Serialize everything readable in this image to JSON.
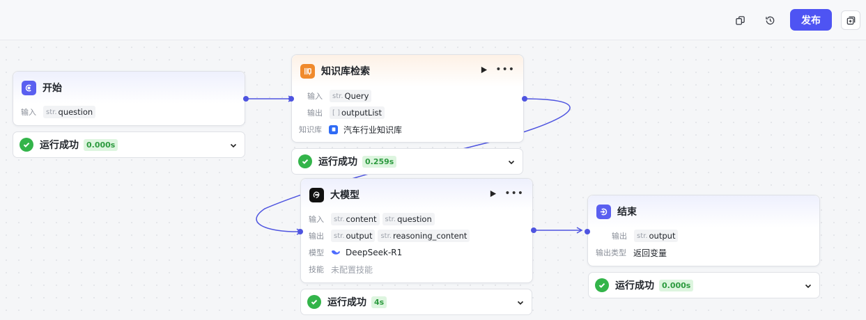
{
  "toolbar": {
    "icons": [
      "copy-icon",
      "history-icon",
      "import-icon"
    ],
    "publish_label": "发布"
  },
  "nodes": {
    "start": {
      "title": "开始",
      "icon": "start-icon",
      "input_label": "输入",
      "input_type": "str.",
      "input_name": "question",
      "status": "运行成功",
      "time": "0.000s"
    },
    "kb": {
      "title": "知识库检索",
      "icon": "knowledge-search-icon",
      "input_label": "输入",
      "input_type": "str.",
      "input_name": "Query",
      "output_label": "输出",
      "output_type": "[ ]",
      "output_name": "outputList",
      "kb_label": "知识库",
      "kb_name": "汽车行业知识库",
      "status": "运行成功",
      "time": "0.259s"
    },
    "llm": {
      "title": "大模型",
      "icon": "llm-icon",
      "input_label": "输入",
      "inputs": [
        {
          "type": "str.",
          "name": "content"
        },
        {
          "type": "str.",
          "name": "question"
        }
      ],
      "output_label": "输出",
      "outputs": [
        {
          "type": "str.",
          "name": "output"
        },
        {
          "type": "str.",
          "name": "reasoning_content"
        }
      ],
      "model_label": "模型",
      "model_name": "DeepSeek-R1",
      "skill_label": "技能",
      "skill_value": "未配置技能",
      "status": "运行成功",
      "time": "4s"
    },
    "end": {
      "title": "结束",
      "icon": "end-icon",
      "output_label": "输出",
      "output_type": "str.",
      "output_name": "output",
      "output_type_label": "输出类型",
      "output_type_value": "返回变量",
      "status": "运行成功",
      "time": "0.000s"
    }
  },
  "colors": {
    "accent": "#4e54f3",
    "success": "#33b44a",
    "edge": "#4e54e0",
    "kb_orange": "#f08a2c"
  }
}
